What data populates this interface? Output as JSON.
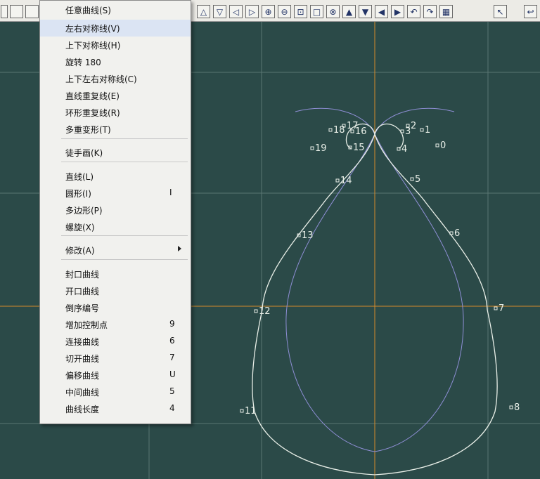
{
  "toolbar": {
    "buttons": [
      {
        "name": "triangle-up-icon",
        "glyph": "△"
      },
      {
        "name": "triangle-down-icon",
        "glyph": "▽"
      },
      {
        "name": "triangle-left-icon",
        "glyph": "◁"
      },
      {
        "name": "triangle-right-icon",
        "glyph": "▷"
      },
      {
        "name": "zoom-in-icon",
        "glyph": "⊕"
      },
      {
        "name": "zoom-out-icon",
        "glyph": "⊖"
      },
      {
        "name": "zoom-window-icon",
        "glyph": "⊡"
      },
      {
        "name": "rectangle-icon",
        "glyph": "□"
      },
      {
        "name": "zoom-extents-icon",
        "glyph": "⊗"
      },
      {
        "name": "solid-up-icon",
        "glyph": "▲"
      },
      {
        "name": "solid-down-icon",
        "glyph": "▼"
      },
      {
        "name": "solid-left-icon",
        "glyph": "◀"
      },
      {
        "name": "solid-right-icon",
        "glyph": "▶"
      },
      {
        "name": "rotate-left-icon",
        "glyph": "↶"
      },
      {
        "name": "rotate-right-icon",
        "glyph": "↷"
      },
      {
        "name": "grid-pattern-icon",
        "glyph": "▦"
      },
      {
        "name": "pointer-icon",
        "glyph": "↖"
      },
      {
        "name": "undo-icon",
        "glyph": "↩"
      }
    ]
  },
  "menu": {
    "items": [
      {
        "label": "任意曲线(S)",
        "key": ""
      },
      {
        "label": "左右对称线(V)",
        "key": ""
      },
      {
        "label": "上下对称线(H)",
        "key": ""
      },
      {
        "label": "旋转 180",
        "key": ""
      },
      {
        "label": "上下左右对称线(C)",
        "key": ""
      },
      {
        "label": "直线重复线(E)",
        "key": ""
      },
      {
        "label": "环形重复线(R)",
        "key": ""
      },
      {
        "label": "多重变形(T)",
        "key": ""
      },
      {
        "label": "徒手画(K)",
        "key": ""
      },
      {
        "label": "直线(L)",
        "key": ""
      },
      {
        "label": "圆形(I)",
        "key": "I"
      },
      {
        "label": "多边形(P)",
        "key": ""
      },
      {
        "label": "螺旋(X)",
        "key": ""
      },
      {
        "label": "修改(A)",
        "key": ""
      },
      {
        "label": "封口曲线",
        "key": ""
      },
      {
        "label": "开口曲线",
        "key": ""
      },
      {
        "label": "倒序编号",
        "key": ""
      },
      {
        "label": "增加控制点",
        "key": "9"
      },
      {
        "label": "连接曲线",
        "key": "6"
      },
      {
        "label": "切开曲线",
        "key": "7"
      },
      {
        "label": "偏移曲线",
        "key": "U"
      },
      {
        "label": "中间曲线",
        "key": "5"
      },
      {
        "label": "曲线长度",
        "key": "4"
      }
    ]
  },
  "points": [
    "1",
    "2",
    "3",
    "4",
    "5",
    "6",
    "7",
    "8",
    "11",
    "12",
    "13",
    "14",
    "15",
    "16",
    "17",
    "18",
    "19",
    "0"
  ],
  "colors": {
    "canvas": "#2b4a48",
    "grid": "#7f9a96",
    "axis": "#d48a2a",
    "curve": "#e9efe8",
    "guide": "#8f8fd6"
  }
}
